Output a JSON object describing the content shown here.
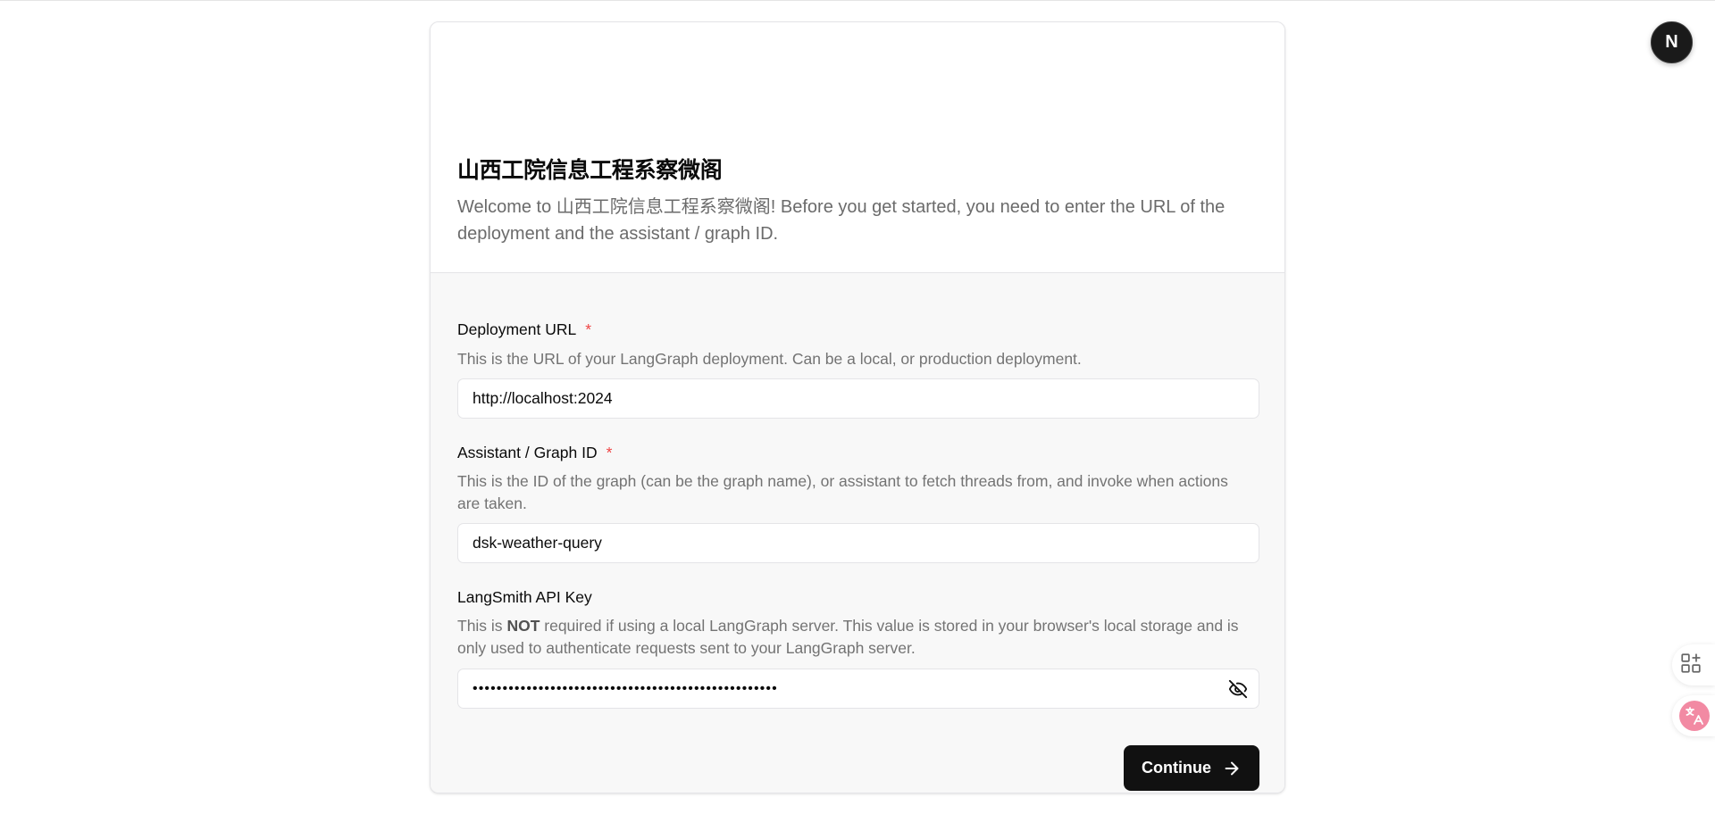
{
  "header": {
    "title": "山西工院信息工程系察微阁",
    "description": "Welcome to 山西工院信息工程系察微阁! Before you get started, you need to enter the URL of the deployment and the assistant / graph ID."
  },
  "form": {
    "deployment_url": {
      "label": "Deployment URL",
      "required_mark": "*",
      "help": "This is the URL of your LangGraph deployment. Can be a local, or production deployment.",
      "value": "http://localhost:2024"
    },
    "assistant_id": {
      "label": "Assistant / Graph ID",
      "required_mark": "*",
      "help": "This is the ID of the graph (can be the graph name), or assistant to fetch threads from, and invoke when actions are taken.",
      "value": "dsk-weather-query"
    },
    "api_key": {
      "label": "LangSmith API Key",
      "help_prefix": "This is ",
      "help_emphasis": "NOT",
      "help_suffix": " required if using a local LangGraph server. This value is stored in your browser's local storage and is only used to authenticate requests sent to your LangGraph server.",
      "masked_value": "•••••••••••••••••••••••••••••••••••••••••••••••••••",
      "toggle_icon": "eye-off-icon"
    },
    "submit_label": "Continue",
    "submit_icon": "arrow-right-icon"
  },
  "floating": {
    "avatar_letter": "N",
    "side_tools": [
      "apps-icon",
      "translate-icon"
    ],
    "accent_translate": "#f28aa3"
  }
}
